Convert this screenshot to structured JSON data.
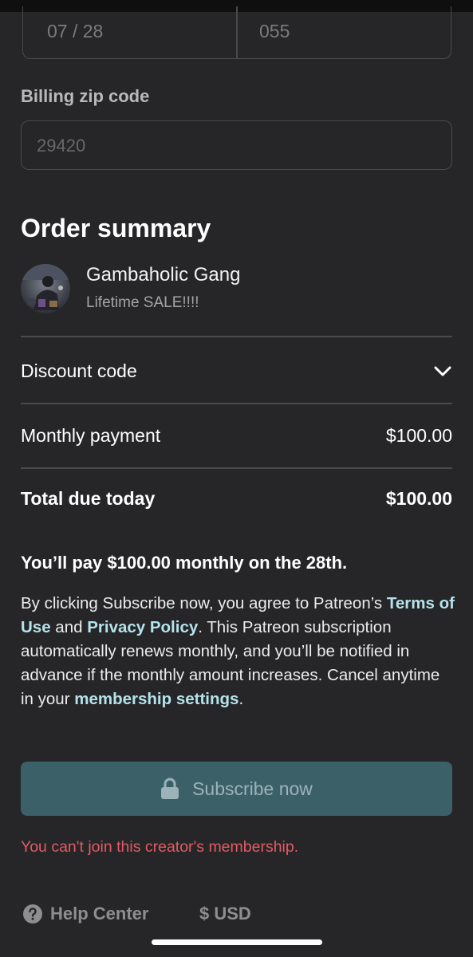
{
  "payment": {
    "expiry_value": "07 / 28",
    "cvc_value": "055",
    "zip_label": "Billing zip code",
    "zip_placeholder": "29420"
  },
  "summary": {
    "heading": "Order summary",
    "creator_name": "Gambaholic Gang",
    "tier_name": "Lifetime SALE!!!!",
    "discount_label": "Discount code",
    "monthly_label": "Monthly payment",
    "monthly_value": "$100.00",
    "total_label": "Total due today",
    "total_value": "$100.00"
  },
  "notice": {
    "pay_note": "You’ll pay $100.00 monthly on the 28th.",
    "legal_1": "By clicking Subscribe now, you agree to Patreon’s ",
    "terms_link": "Terms of Use",
    "legal_2": " and ",
    "privacy_link": "Privacy Policy",
    "legal_3": ". This Patreon subscription automatically renews monthly, and you’ll be notified in advance if the monthly amount increases. Cancel anytime in your ",
    "settings_link": "membership settings",
    "legal_4": "."
  },
  "actions": {
    "subscribe_label": "Subscribe now",
    "error_text": "You can't join this creator's membership."
  },
  "footer": {
    "help_label": "Help Center",
    "currency_label": "$ USD"
  },
  "icons": {
    "chevron": "chevron-down-icon",
    "lock": "lock-icon",
    "help": "question-circle-icon"
  },
  "colors": {
    "background": "#262628",
    "link": "#b4e3ec",
    "button": "#3c6068",
    "error": "#e25a63"
  }
}
